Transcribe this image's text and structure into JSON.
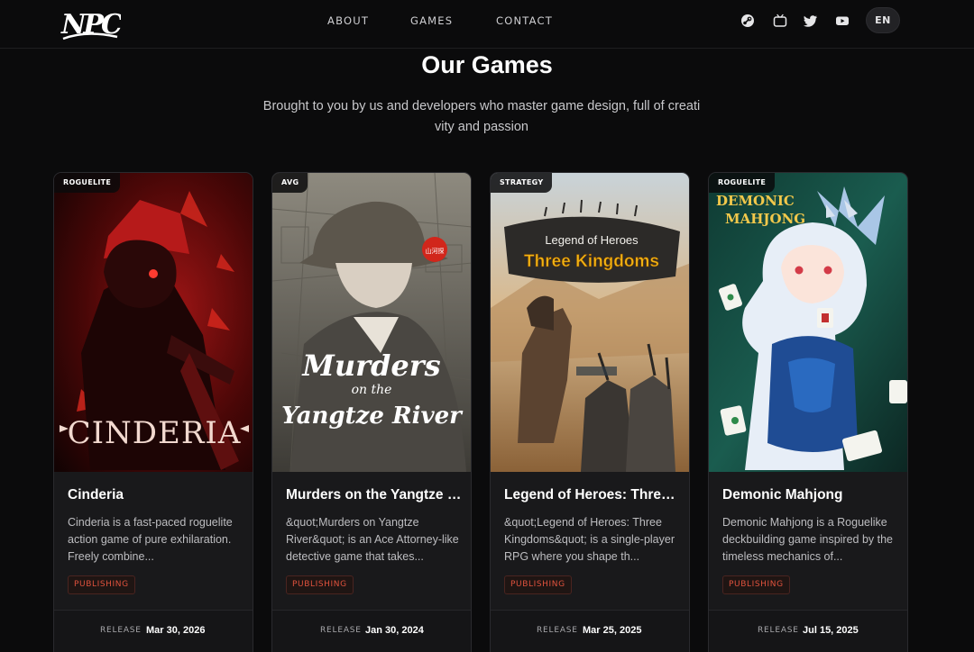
{
  "header": {
    "logo_text": "NPC",
    "nav": [
      {
        "label": "ABOUT"
      },
      {
        "label": "GAMES"
      },
      {
        "label": "CONTACT"
      }
    ],
    "social_icons": [
      "steam-icon",
      "bilibili-icon",
      "twitter-icon",
      "youtube-icon"
    ],
    "language": "EN"
  },
  "section": {
    "title": "Our Games",
    "subtitle": "Brought to you by us and developers who master game design, full of creativity and passion"
  },
  "colors": {
    "background": "#0b0b0c",
    "card": "#19191b",
    "accent": "#e0523d"
  },
  "games": [
    {
      "genre": "ROGUELITE",
      "art_text": "CINDERIA",
      "title": "Cinderia",
      "description": "Cinderia is a fast-paced roguelite action game of pure exhilaration. Freely combine...",
      "tag": "PUBLISHING",
      "release_label": "RELEASE",
      "release_date": "Mar 30, 2026"
    },
    {
      "genre": "AVG",
      "art_text_1": "Murders",
      "art_text_2": "on the",
      "art_text_3": "Yangtze River",
      "art_seal": "山河探",
      "title": "Murders on the Yangtze River",
      "description": "&quot;Murders on Yangtze River&quot; is an Ace Attorney-like detective game that takes...",
      "tag": "PUBLISHING",
      "release_label": "RELEASE",
      "release_date": "Jan 30, 2024"
    },
    {
      "genre": "STRATEGY",
      "art_text_1": "Legend of Heroes",
      "art_text_2": "Three Kingdoms",
      "title": "Legend of Heroes: Three Kingdoms",
      "description": "&quot;Legend of Heroes: Three Kingdoms&quot; is a single-player RPG where you shape th...",
      "tag": "PUBLISHING",
      "release_label": "RELEASE",
      "release_date": "Mar 25, 2025"
    },
    {
      "genre": "ROGUELITE",
      "art_text_1": "DEMONIC",
      "art_text_2": "MAHJONG",
      "title": "Demonic Mahjong",
      "description": "Demonic Mahjong is a Roguelike deckbuilding game inspired by the timeless mechanics of...",
      "tag": "PUBLISHING",
      "release_label": "RELEASE",
      "release_date": "Jul 15, 2025"
    }
  ]
}
